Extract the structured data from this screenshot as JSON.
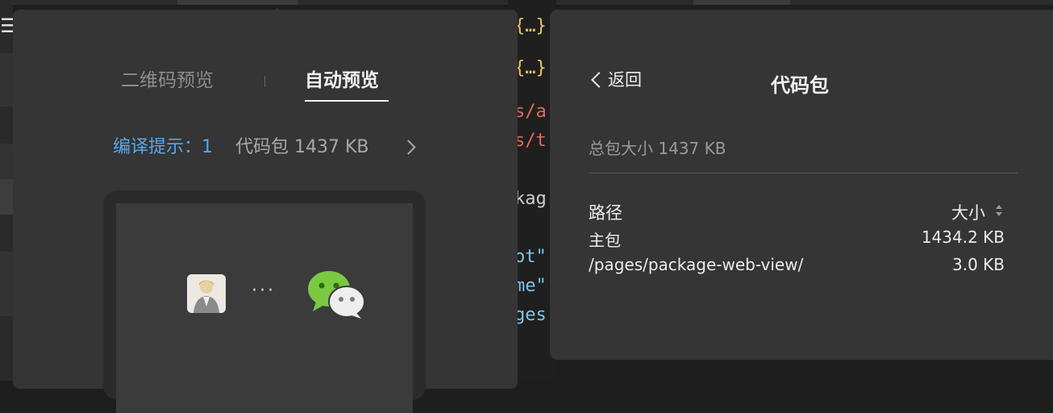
{
  "editor": {
    "menu_icon": "hamburger-icon",
    "lines": [
      {
        "text": "{…} a",
        "color": "#e9c46a"
      },
      {
        "text": "{…} a",
        "color": "#e9c46a"
      },
      {
        "text": "s/a",
        "color": "#e06c5b"
      },
      {
        "text": "s/t",
        "color": "#e06c5b"
      },
      {
        "text": "kag",
        "color": "#cfcfcf"
      },
      {
        "text": "ot\"",
        "color": "#7cc4e8"
      },
      {
        "text": "me\"",
        "color": "#7cc4e8"
      },
      {
        "text": "ges",
        "color": "#7cc4e8"
      }
    ]
  },
  "preview": {
    "tabs": [
      {
        "label": "二维码预览",
        "active": false
      },
      {
        "label": "自动预览",
        "active": true
      }
    ],
    "compile_label": "编译提示：",
    "compile_count": "1",
    "package_size": "代码包 1437 KB",
    "chevron_icon": "chevron-right-icon",
    "separator": "···",
    "brand_color": "#7ac943"
  },
  "code_package": {
    "back_label": "返回",
    "back_icon": "chevron-left-icon",
    "title": "代码包",
    "total_size": "总包大小 1437 KB",
    "columns": {
      "path": "路径",
      "size": "大小"
    },
    "sort_icon": "sort-icon",
    "rows": [
      {
        "path": "主包",
        "size": "1434.2 KB"
      },
      {
        "path": "/pages/package-web-view/",
        "size": "3.0 KB"
      }
    ]
  }
}
